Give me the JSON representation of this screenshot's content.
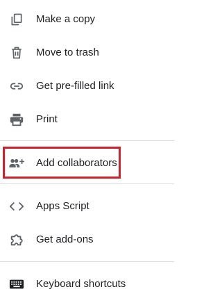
{
  "menu": {
    "items": [
      {
        "label": "Make a copy",
        "icon": "copy-icon"
      },
      {
        "label": "Move to trash",
        "icon": "trash-icon"
      },
      {
        "label": "Get pre-filled link",
        "icon": "link-icon"
      },
      {
        "label": "Print",
        "icon": "printer-icon"
      },
      {
        "label": "Add collaborators",
        "icon": "add-people-icon"
      },
      {
        "label": "Apps Script",
        "icon": "code-icon"
      },
      {
        "label": "Get add-ons",
        "icon": "puzzle-icon"
      },
      {
        "label": "Keyboard shortcuts",
        "icon": "keyboard-icon"
      }
    ]
  },
  "colors": {
    "text": "#202124",
    "icon": "#5f6368",
    "divider": "#dadce0",
    "highlight": "#d0202c"
  }
}
